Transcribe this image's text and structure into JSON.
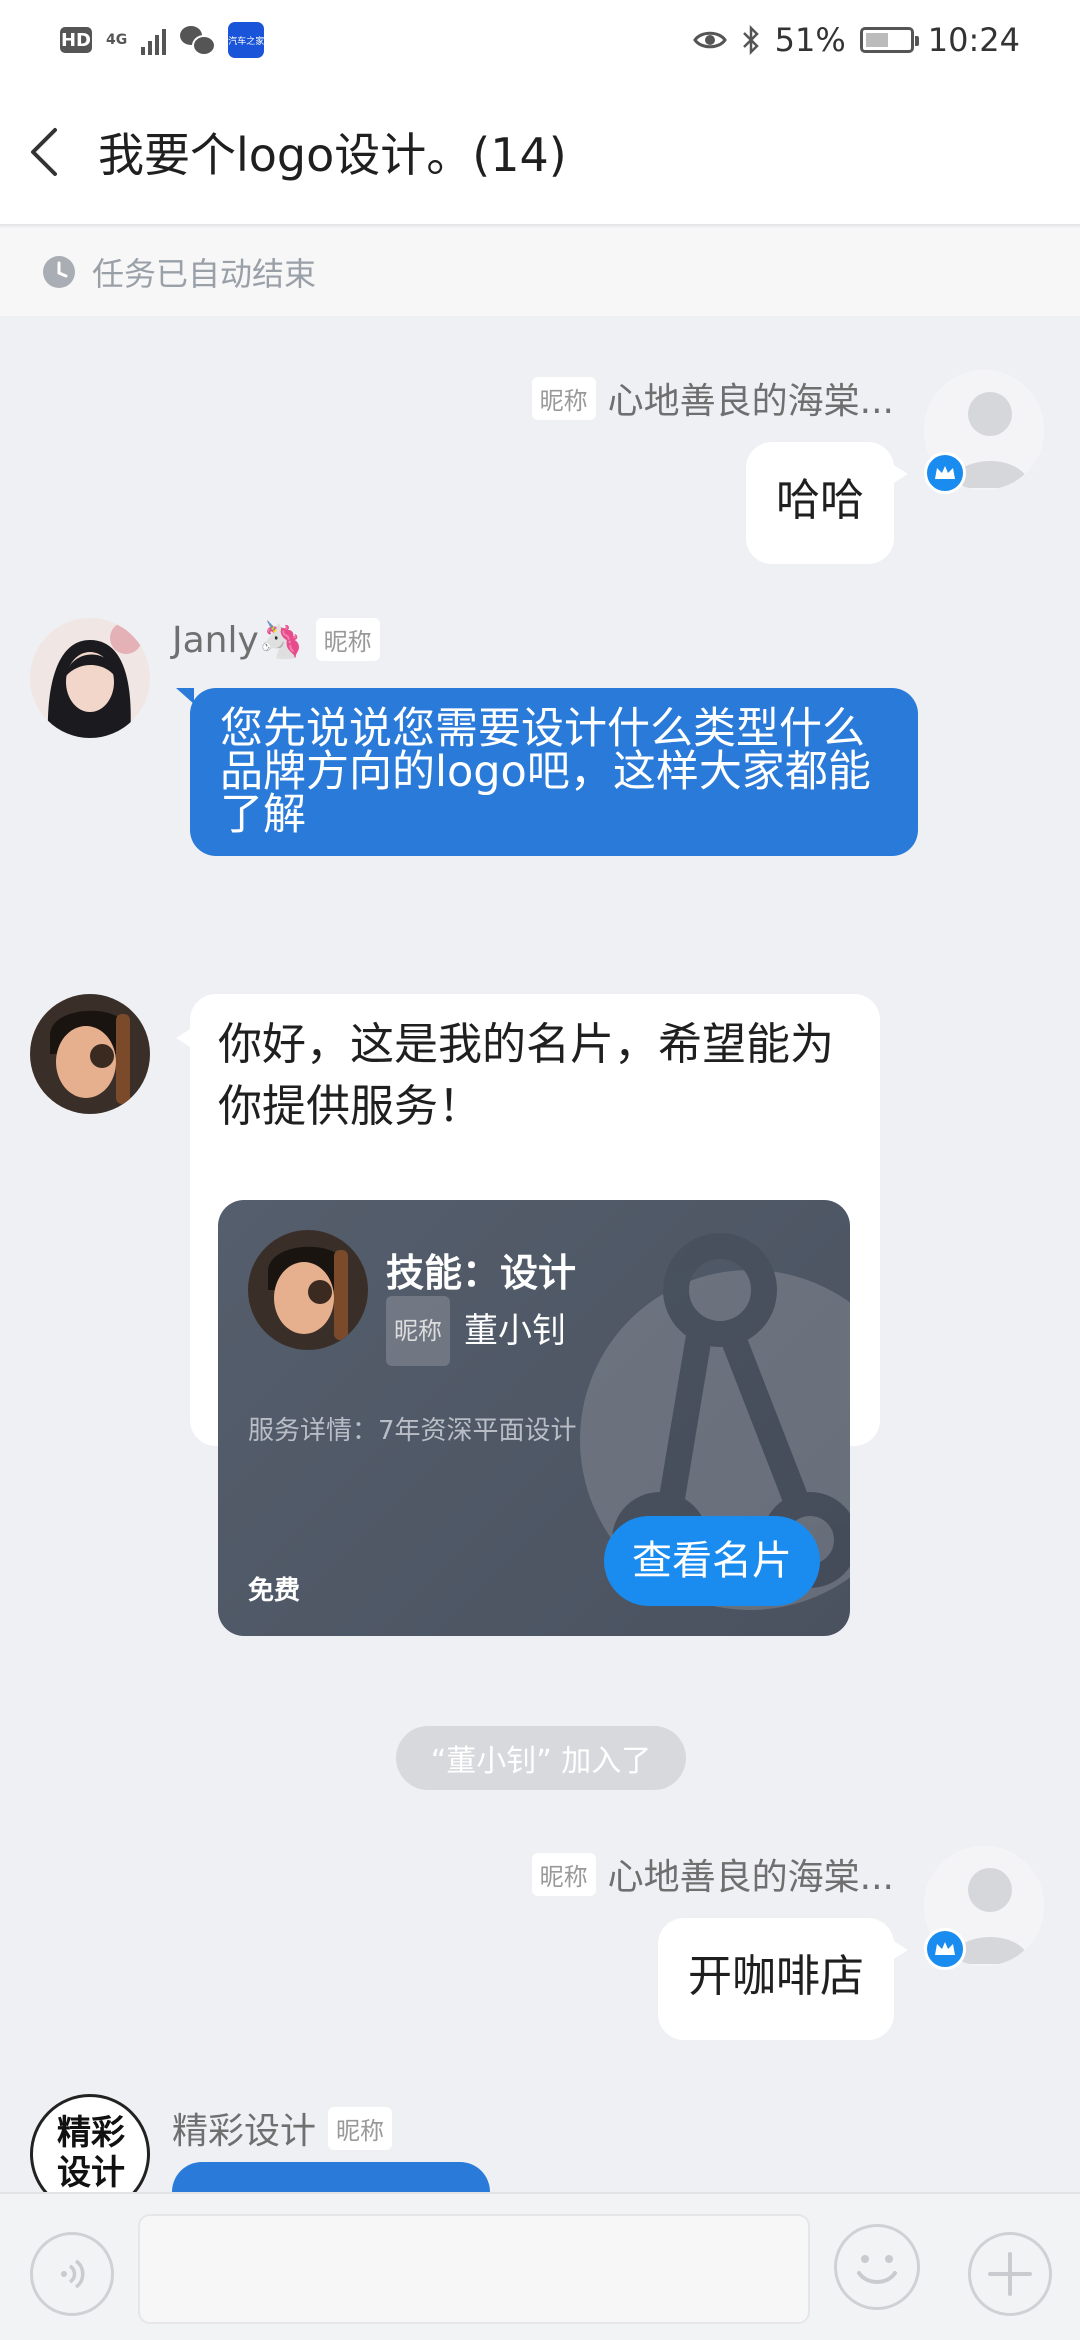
{
  "status_bar": {
    "network_label": "4G",
    "app_badge": "汽车之家",
    "battery": "51%",
    "time": "10:24"
  },
  "header": {
    "title": "我要个logo设计。(14)"
  },
  "notice": {
    "text": "任务已自动结束"
  },
  "messages": {
    "m1": {
      "nick_tag": "昵称",
      "name": "心地善良的海棠...",
      "text": "哈哈"
    },
    "m2": {
      "name": "Janly🦄",
      "nick_tag": "昵称",
      "text": "您先说说您需要设计什么类型什么品牌方向的logo吧，这样大家都能了解"
    },
    "m3": {
      "text": "你好，这是我的名片，希望能为你提供服务！",
      "card": {
        "skill": "技能：设计",
        "nick_tag": "昵称",
        "name": "董小钊",
        "detail": "服务详情：7年资深平面设计",
        "price": "免费",
        "button": "查看名片"
      }
    },
    "system": {
      "text": "“董小钊” 加入了"
    },
    "m4": {
      "nick_tag": "昵称",
      "name": "心地善良的海棠...",
      "text": "开咖啡店"
    },
    "m5": {
      "name": "精彩设计",
      "nick_tag": "昵称",
      "avatar_text": "精彩设计"
    }
  },
  "colors": {
    "accent_blue": "#2a7bd9",
    "button_blue": "#1a8cf0",
    "background": "#eff0f4"
  }
}
